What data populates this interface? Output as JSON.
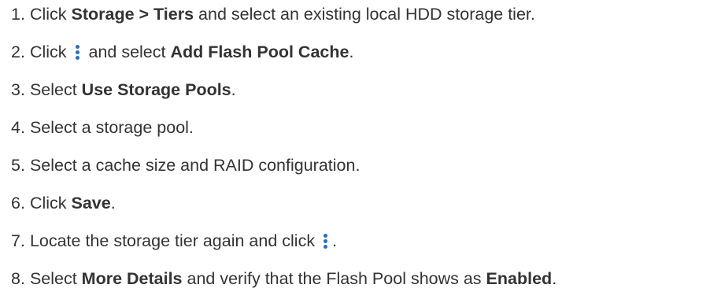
{
  "steps": [
    {
      "num": "1.",
      "t1": "Click ",
      "b1": "Storage > Tiers",
      "t2": " and select an existing local HDD storage tier."
    },
    {
      "num": "2.",
      "t1": "Click ",
      "t2": " and select ",
      "b1": "Add Flash Pool Cache",
      "t3": "."
    },
    {
      "num": "3.",
      "t1": "Select ",
      "b1": "Use Storage Pools",
      "t2": "."
    },
    {
      "num": "4.",
      "t1": "Select a storage pool."
    },
    {
      "num": "5.",
      "t1": "Select a cache size and RAID configuration."
    },
    {
      "num": "6.",
      "t1": "Click ",
      "b1": "Save",
      "t2": "."
    },
    {
      "num": "7.",
      "t1": "Locate the storage tier again and click ",
      "t2": "."
    },
    {
      "num": "8.",
      "t1": "Select ",
      "b1": "More Details",
      "t2": " and verify that the Flash Pool shows as ",
      "b2": "Enabled",
      "t3": "."
    }
  ],
  "icons": {
    "menu": "kebab-menu-icon",
    "color": "#1f6fd1"
  }
}
